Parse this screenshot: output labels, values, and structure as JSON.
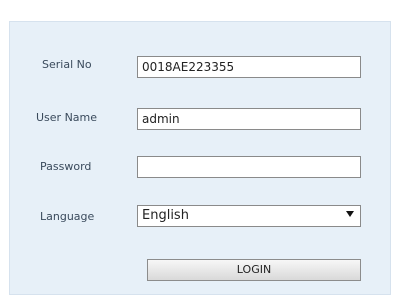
{
  "form": {
    "serial_label": "Serial No",
    "serial_value": "0018AE223355",
    "username_label": "User Name",
    "username_value": "admin",
    "password_label": "Password",
    "password_value": "",
    "language_label": "Language",
    "language_selected": "English",
    "login_label": "LOGIN"
  },
  "colors": {
    "panel_background": "#e7f0f8",
    "label_text": "#3a4a5c"
  }
}
